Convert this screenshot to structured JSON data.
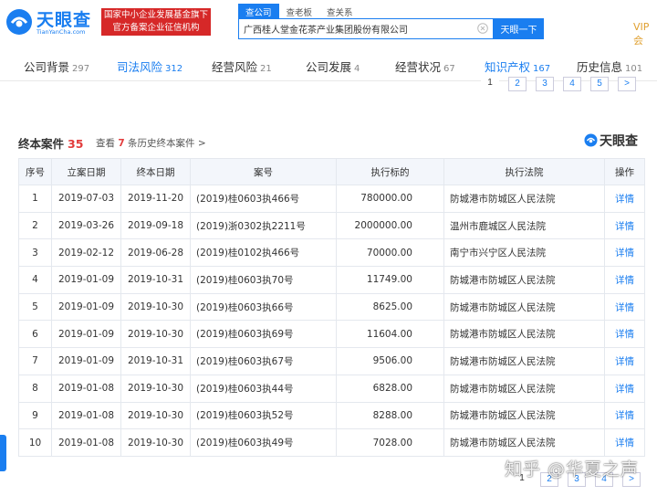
{
  "header": {
    "logo_text": "天眼查",
    "logo_sub": "TianYanCha.com",
    "badge_line1": "国家中小企业发展基金旗下",
    "badge_line2": "官方备案企业征信机构",
    "search_tabs": [
      "查公司",
      "查老板",
      "查关系"
    ],
    "search_value": "广西桂人堂金花茶产业集团股份有限公司",
    "search_button": "天眼一下",
    "vip": "VIP会"
  },
  "nav": [
    {
      "label": "公司背景",
      "count": "297"
    },
    {
      "label": "司法风险",
      "count": "312"
    },
    {
      "label": "经营风险",
      "count": "21"
    },
    {
      "label": "公司发展",
      "count": "4"
    },
    {
      "label": "经营状况",
      "count": "67"
    },
    {
      "label": "知识产权",
      "count": "167"
    },
    {
      "label": "历史信息",
      "count": "101"
    }
  ],
  "pager_top": [
    "1",
    "2",
    "3",
    "4",
    "5",
    ">"
  ],
  "section": {
    "title": "终本案件",
    "count": "35",
    "history_prefix": "查看",
    "history_count": "7",
    "history_suffix": "条历史终本案件 >",
    "logo": "天眼查"
  },
  "table": {
    "headers": [
      "序号",
      "立案日期",
      "终本日期",
      "案号",
      "执行标的",
      "执行法院",
      "操作"
    ],
    "rows": [
      [
        "1",
        "2019-07-03",
        "2019-11-20",
        "(2019)桂0603执466号",
        "780000.00",
        "防城港市防城区人民法院",
        "详情"
      ],
      [
        "2",
        "2019-03-26",
        "2019-09-18",
        "(2019)浙0302执2211号",
        "2000000.00",
        "温州市鹿城区人民法院",
        "详情"
      ],
      [
        "3",
        "2019-02-12",
        "2019-06-28",
        "(2019)桂0102执466号",
        "70000.00",
        "南宁市兴宁区人民法院",
        "详情"
      ],
      [
        "4",
        "2019-01-09",
        "2019-10-31",
        "(2019)桂0603执70号",
        "11749.00",
        "防城港市防城区人民法院",
        "详情"
      ],
      [
        "5",
        "2019-01-09",
        "2019-10-30",
        "(2019)桂0603执66号",
        "8625.00",
        "防城港市防城区人民法院",
        "详情"
      ],
      [
        "6",
        "2019-01-09",
        "2019-10-30",
        "(2019)桂0603执69号",
        "11604.00",
        "防城港市防城区人民法院",
        "详情"
      ],
      [
        "7",
        "2019-01-09",
        "2019-10-31",
        "(2019)桂0603执67号",
        "9506.00",
        "防城港市防城区人民法院",
        "详情"
      ],
      [
        "8",
        "2019-01-08",
        "2019-10-30",
        "(2019)桂0603执44号",
        "6828.00",
        "防城港市防城区人民法院",
        "详情"
      ],
      [
        "9",
        "2019-01-08",
        "2019-10-30",
        "(2019)桂0603执52号",
        "8288.00",
        "防城港市防城区人民法院",
        "详情"
      ],
      [
        "10",
        "2019-01-08",
        "2019-10-30",
        "(2019)桂0603执49号",
        "7028.00",
        "防城港市防城区人民法院",
        "详情"
      ]
    ]
  },
  "pager_bottom": [
    "1",
    "2",
    "3",
    "4",
    ">"
  ],
  "watermark": "知乎 @华夏之声",
  "colors": {
    "brand": "#1a7ef0",
    "badge": "#d62828",
    "count_red": "#e23c3c"
  }
}
